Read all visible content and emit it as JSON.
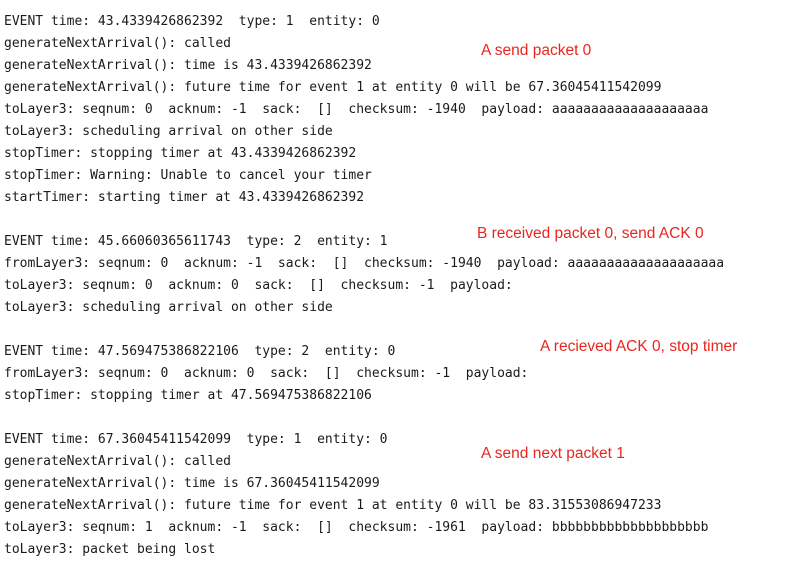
{
  "log_lines": [
    "EVENT time: 43.4339426862392  type: 1  entity: 0",
    "generateNextArrival(): called",
    "generateNextArrival(): time is 43.4339426862392",
    "generateNextArrival(): future time for event 1 at entity 0 will be 67.36045411542099",
    "toLayer3: seqnum: 0  acknum: -1  sack:  []  checksum: -1940  payload: aaaaaaaaaaaaaaaaaaaa",
    "toLayer3: scheduling arrival on other side",
    "stopTimer: stopping timer at 43.4339426862392",
    "stopTimer: Warning: Unable to cancel your timer",
    "startTimer: starting timer at 43.4339426862392",
    "",
    "EVENT time: 45.66060365611743  type: 2  entity: 1",
    "fromLayer3: seqnum: 0  acknum: -1  sack:  []  checksum: -1940  payload: aaaaaaaaaaaaaaaaaaaa",
    "toLayer3: seqnum: 0  acknum: 0  sack:  []  checksum: -1  payload:",
    "toLayer3: scheduling arrival on other side",
    "",
    "EVENT time: 47.569475386822106  type: 2  entity: 0",
    "fromLayer3: seqnum: 0  acknum: 0  sack:  []  checksum: -1  payload:",
    "stopTimer: stopping timer at 47.569475386822106",
    "",
    "EVENT time: 67.36045411542099  type: 1  entity: 0",
    "generateNextArrival(): called",
    "generateNextArrival(): time is 67.36045411542099",
    "generateNextArrival(): future time for event 1 at entity 0 will be 83.31553086947233",
    "toLayer3: seqnum: 1  acknum: -1  sack:  []  checksum: -1961  payload: bbbbbbbbbbbbbbbbbbbb",
    "toLayer3: packet being lost"
  ],
  "annotations": [
    "A send packet 0",
    "B received packet 0, send ACK 0",
    "A recieved ACK 0, stop timer",
    "A send next packet 1"
  ],
  "colors": {
    "text": "#1a1a1a",
    "annotation": "#e8261f",
    "background": "#ffffff"
  }
}
